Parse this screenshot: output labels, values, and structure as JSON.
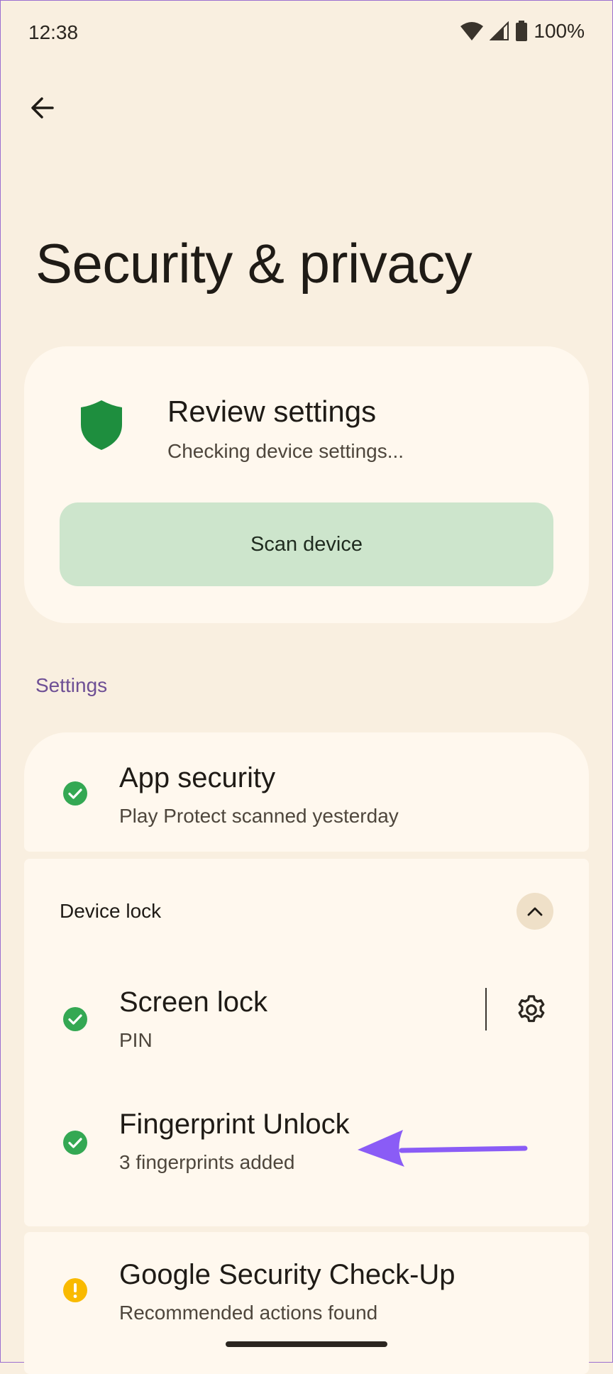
{
  "status_bar": {
    "time": "12:38",
    "battery_percent": "100%",
    "icons": [
      "wifi-icon",
      "signal-icon",
      "battery-icon"
    ]
  },
  "header": {
    "back_icon": "arrow-left-icon",
    "title": "Security & privacy"
  },
  "review_card": {
    "icon": "shield-icon",
    "title": "Review settings",
    "subtitle": "Checking device settings...",
    "scan_button_label": "Scan device"
  },
  "settings_section": {
    "header": "Settings",
    "app_security": {
      "title": "App security",
      "summary": "Play Protect scanned yesterday",
      "status": "ok"
    },
    "device_lock": {
      "label": "Device lock",
      "expanded": true,
      "items": [
        {
          "title": "Screen lock",
          "summary": "PIN",
          "status": "ok",
          "has_settings": true
        },
        {
          "title": "Fingerprint Unlock",
          "summary": "3 fingerprints added",
          "status": "ok",
          "has_settings": false
        }
      ]
    },
    "google_check_up": {
      "title": "Google Security Check-Up",
      "summary": "Recommended actions found",
      "status": "warning"
    }
  },
  "colors": {
    "background": "#f9efe0",
    "card": "#fff8ee",
    "scan_button": "#cde5cc",
    "ok_green": "#34a853",
    "shield_green": "#1e8e3e",
    "warning_yellow": "#f9ba00",
    "section_header": "#6e4f95",
    "annotation_arrow": "#8a5cf6"
  }
}
